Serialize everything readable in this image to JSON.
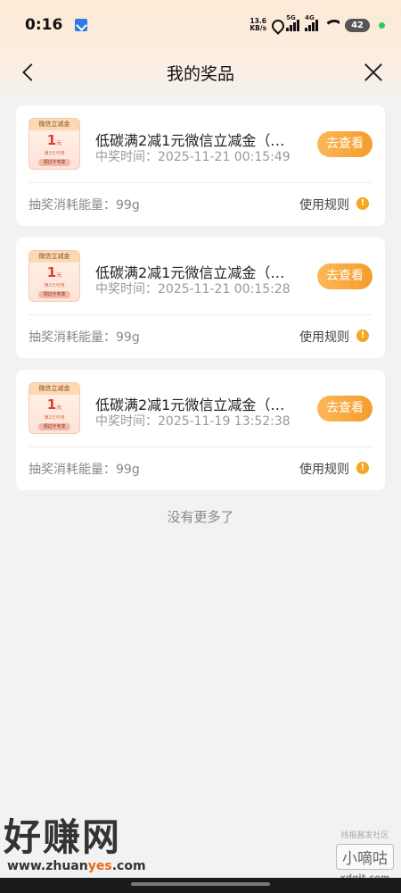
{
  "status_bar": {
    "time": "0:16",
    "net_speed_value": "13.6",
    "net_speed_unit": "KB/s",
    "signal1_label": "5G",
    "signal2_label": "4G",
    "battery": "42"
  },
  "nav": {
    "title": "我的奖品"
  },
  "prizes": [
    {
      "coupon_head": "微信立减金",
      "coupon_amount": "1",
      "coupon_unit": "元",
      "coupon_cond": "满2元可用",
      "coupon_tag": "领过卡专享",
      "title": "低碳满2减1元微信立减金（…",
      "time_label": "中奖时间：",
      "time": "2025-11-21 00:15:49",
      "button": "去查看",
      "energy_label": "抽奖消耗能量：",
      "energy": "99g",
      "rules": "使用规则"
    },
    {
      "coupon_head": "微信立减金",
      "coupon_amount": "1",
      "coupon_unit": "元",
      "coupon_cond": "满2元可用",
      "coupon_tag": "领过卡专享",
      "title": "低碳满2减1元微信立减金（…",
      "time_label": "中奖时间：",
      "time": "2025-11-21 00:15:28",
      "button": "去查看",
      "energy_label": "抽奖消耗能量：",
      "energy": "99g",
      "rules": "使用规则"
    },
    {
      "coupon_head": "微信立减金",
      "coupon_amount": "1",
      "coupon_unit": "元",
      "coupon_cond": "满2元可用",
      "coupon_tag": "领过卡专享",
      "title": "低碳满2减1元微信立减金（…",
      "time_label": "中奖时间：",
      "time": "2025-11-19 13:52:38",
      "button": "去查看",
      "energy_label": "抽奖消耗能量：",
      "energy": "99g",
      "rules": "使用规则"
    }
  ],
  "footer_text": "没有更多了",
  "watermarks": {
    "left_big": "好赚网",
    "left_url_a": "www.zhuan",
    "left_url_b": "yes",
    "left_url_c": ".com",
    "right_small": "线报酱发社区",
    "right_box": "小嘀咕",
    "right_domain": "xdgit.com"
  },
  "colors": {
    "accent": "#f59c2a",
    "coupon_red": "#e53b2b",
    "info": "#f5a623"
  }
}
